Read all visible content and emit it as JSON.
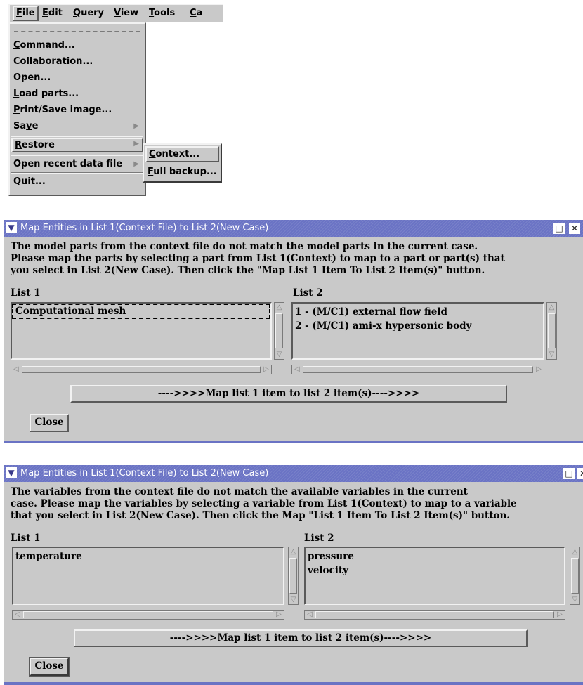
{
  "menubar": {
    "items": [
      {
        "mnemonic": "F",
        "rest": "ile"
      },
      {
        "mnemonic": "E",
        "rest": "dit"
      },
      {
        "mnemonic": "Q",
        "rest": "uery"
      },
      {
        "mnemonic": "V",
        "rest": "iew"
      },
      {
        "mnemonic": "T",
        "rest": "ools"
      },
      {
        "mnemonic": "C",
        "rest": "a"
      }
    ]
  },
  "file_menu": {
    "items": [
      {
        "pre": "",
        "mn": "C",
        "post": "ommand..."
      },
      {
        "pre": "Colla",
        "mn": "b",
        "post": "oration..."
      },
      {
        "pre": "",
        "mn": "O",
        "post": "pen..."
      },
      {
        "pre": "",
        "mn": "L",
        "post": "oad parts..."
      },
      {
        "pre": "",
        "mn": "P",
        "post": "rint/Save image..."
      },
      {
        "pre": "Sa",
        "mn": "v",
        "post": "e"
      },
      {
        "pre": "",
        "mn": "R",
        "post": "estore"
      },
      {
        "pre": "Open recent data file",
        "mn": "",
        "post": ""
      },
      {
        "pre": "",
        "mn": "Q",
        "post": "uit..."
      }
    ],
    "submenu_arrow": "▶"
  },
  "restore_submenu": {
    "items": [
      {
        "mn": "C",
        "post": "ontext..."
      },
      {
        "mn": "F",
        "post": "ull backup..."
      }
    ]
  },
  "dialog1": {
    "title": "Map Entities in List 1(Context File) to List 2(New Case)",
    "message": [
      "The model parts from the context file do not match the model parts in the current case.",
      "Please map the parts by selecting a part from List 1(Context) to map to a part or part(s) that",
      "you select in List 2(New Case).  Then click the \"Map List 1 Item To List 2 Item(s)\" button."
    ],
    "list1_label": "List 1",
    "list2_label": "List 2",
    "list1_items": [
      "Computational mesh"
    ],
    "list2_items": [
      "1 - (M/C1) external flow field",
      "2 - (M/C1) ami-x hypersonic body"
    ],
    "map_button": "---->>>>Map list 1 item to list 2 item(s)---->>>>",
    "close_button": "Close"
  },
  "dialog2": {
    "title": "Map Entities in List 1(Context File) to List 2(New Case)",
    "message": [
      "The variables from the context file do not match the available variables in the current",
      "case.  Please map the variables by selecting a variable from List 1(Context) to map to a variable",
      "that you select in List 2(New Case).  Then click the Map \"List 1 Item To List 2 Item(s)\" button."
    ],
    "list1_label": "List 1",
    "list2_label": "List 2",
    "list1_items": [
      "temperature"
    ],
    "list2_items": [
      "pressure",
      "velocity"
    ],
    "map_button": "---->>>>Map list 1 item to list 2 item(s)---->>>>",
    "close_button": "Close"
  },
  "icons": {
    "chevron": "▼",
    "maximize": "□",
    "close": "✕",
    "scroll_up": "△",
    "scroll_down": "▽",
    "scroll_left": "◁",
    "scroll_right": "▷"
  }
}
